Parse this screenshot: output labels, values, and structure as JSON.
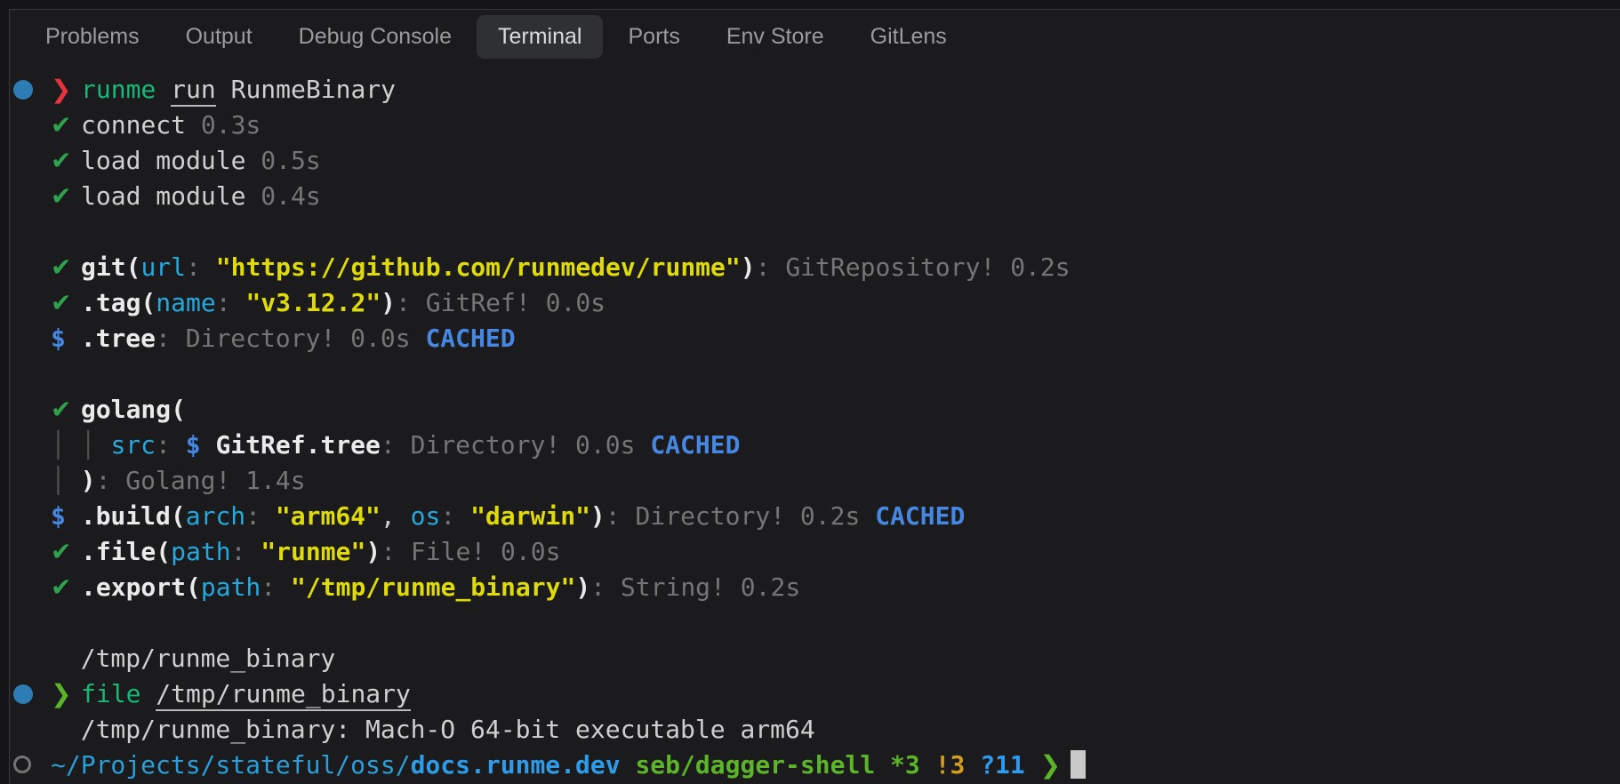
{
  "colors": {
    "panel_background": "#1b1b1d",
    "panel_border": "#3a3a3e",
    "tab_inactive_text": "#9b9b9b",
    "tab_active_background": "#2f3033",
    "tab_active_text": "#dadada",
    "terminal_foreground": "#cfcfcf",
    "result_gray": "#757575",
    "check_green": "#2fa24d",
    "command_emerald": "#17b877",
    "prompt_red": "#e6333d",
    "prompt_lime": "#5cb428",
    "param_cyan": "#25a8de",
    "string_yellow": "#dfdb0a",
    "cached_blue": "#4687e2",
    "untracked_blue": "#2d9cf0",
    "modified_orange": "#d29c20",
    "decoration_dot_blue": "#2d7cb5",
    "cursor": "#c9c9c9"
  },
  "tabs": {
    "items": [
      {
        "label": "Problems",
        "active": false
      },
      {
        "label": "Output",
        "active": false
      },
      {
        "label": "Debug Console",
        "active": false
      },
      {
        "label": "Terminal",
        "active": true
      },
      {
        "label": "Ports",
        "active": false
      },
      {
        "label": "Env Store",
        "active": false
      },
      {
        "label": "GitLens",
        "active": false
      }
    ]
  },
  "terminal": {
    "lines": [
      {
        "decoration": {
          "name": "command-decoration-dot",
          "type": "filled"
        },
        "segments": [
          {
            "text": "❯ ",
            "style": "red glyph"
          },
          {
            "text": "runme ",
            "style": "emerald"
          },
          {
            "text": "run",
            "style": "fg underline",
            "link": true
          },
          {
            "text": " RunmeBinary",
            "style": "fg"
          }
        ]
      },
      {
        "segments": [
          {
            "text": "✔ ",
            "style": "green glyph"
          },
          {
            "text": "connect ",
            "style": "fg"
          },
          {
            "text": "0.3s",
            "style": "gray"
          }
        ]
      },
      {
        "segments": [
          {
            "text": "✔ ",
            "style": "green glyph"
          },
          {
            "text": "load module ",
            "style": "fg"
          },
          {
            "text": "0.5s",
            "style": "gray"
          }
        ]
      },
      {
        "segments": [
          {
            "text": "✔ ",
            "style": "green glyph"
          },
          {
            "text": "load module ",
            "style": "fg"
          },
          {
            "text": "0.4s",
            "style": "gray"
          }
        ]
      },
      {
        "segments": []
      },
      {
        "segments": [
          {
            "text": "✔ ",
            "style": "green glyph"
          },
          {
            "text": "git(",
            "style": "boldfg"
          },
          {
            "text": "url",
            "style": "cyan"
          },
          {
            "text": ": ",
            "style": "gray"
          },
          {
            "text": "\"https://github.com/runmedev/runme\"",
            "style": "yellow",
            "link": true
          },
          {
            "text": ")",
            "style": "boldfg"
          },
          {
            "text": ": ",
            "style": "gray"
          },
          {
            "text": "GitRepository! 0.2s",
            "style": "gray"
          }
        ]
      },
      {
        "segments": [
          {
            "text": "✔ ",
            "style": "green glyph"
          },
          {
            "text": ".tag(",
            "style": "boldfg"
          },
          {
            "text": "name",
            "style": "cyan"
          },
          {
            "text": ": ",
            "style": "gray"
          },
          {
            "text": "\"v3.12.2\"",
            "style": "yellow"
          },
          {
            "text": ")",
            "style": "boldfg"
          },
          {
            "text": ": ",
            "style": "gray"
          },
          {
            "text": "GitRef! 0.0s",
            "style": "gray"
          }
        ]
      },
      {
        "segments": [
          {
            "text": "$ ",
            "style": "blue"
          },
          {
            "text": ".tree",
            "style": "boldfg"
          },
          {
            "text": ": ",
            "style": "gray"
          },
          {
            "text": "Directory! 0.0s ",
            "style": "gray"
          },
          {
            "text": "CACHED",
            "style": "blue"
          }
        ]
      },
      {
        "segments": []
      },
      {
        "segments": [
          {
            "text": "✔ ",
            "style": "green glyph"
          },
          {
            "text": "golang(",
            "style": "boldfg"
          }
        ]
      },
      {
        "segments": [
          {
            "text": "│ │ ",
            "style": "dim"
          },
          {
            "text": "src",
            "style": "cyan"
          },
          {
            "text": ": ",
            "style": "gray"
          },
          {
            "text": "$ ",
            "style": "blue"
          },
          {
            "text": "GitRef.tree",
            "style": "boldfg"
          },
          {
            "text": ": ",
            "style": "gray"
          },
          {
            "text": "Directory! 0.0s ",
            "style": "gray"
          },
          {
            "text": "CACHED",
            "style": "blue"
          }
        ]
      },
      {
        "segments": [
          {
            "text": "│ ",
            "style": "dim"
          },
          {
            "text": ")",
            "style": "boldfg"
          },
          {
            "text": ": ",
            "style": "gray"
          },
          {
            "text": "Golang! 1.4s",
            "style": "gray"
          }
        ]
      },
      {
        "segments": [
          {
            "text": "$ ",
            "style": "blue"
          },
          {
            "text": ".build(",
            "style": "boldfg"
          },
          {
            "text": "arch",
            "style": "cyan"
          },
          {
            "text": ": ",
            "style": "gray"
          },
          {
            "text": "\"arm64\"",
            "style": "yellow"
          },
          {
            "text": ", ",
            "style": "fg"
          },
          {
            "text": "os",
            "style": "cyan"
          },
          {
            "text": ": ",
            "style": "gray"
          },
          {
            "text": "\"darwin\"",
            "style": "yellow"
          },
          {
            "text": ")",
            "style": "boldfg"
          },
          {
            "text": ": ",
            "style": "gray"
          },
          {
            "text": "Directory! 0.2s ",
            "style": "gray"
          },
          {
            "text": "CACHED",
            "style": "blue"
          }
        ]
      },
      {
        "segments": [
          {
            "text": "✔ ",
            "style": "green glyph"
          },
          {
            "text": ".file(",
            "style": "boldfg"
          },
          {
            "text": "path",
            "style": "cyan"
          },
          {
            "text": ": ",
            "style": "gray"
          },
          {
            "text": "\"runme\"",
            "style": "yellow"
          },
          {
            "text": ")",
            "style": "boldfg"
          },
          {
            "text": ": ",
            "style": "gray"
          },
          {
            "text": "File! 0.0s",
            "style": "gray"
          }
        ]
      },
      {
        "segments": [
          {
            "text": "✔ ",
            "style": "green glyph"
          },
          {
            "text": ".export(",
            "style": "boldfg"
          },
          {
            "text": "path",
            "style": "cyan"
          },
          {
            "text": ": ",
            "style": "gray"
          },
          {
            "text": "\"/tmp/runme_binary\"",
            "style": "yellow"
          },
          {
            "text": ")",
            "style": "boldfg"
          },
          {
            "text": ": ",
            "style": "gray"
          },
          {
            "text": "String! 0.2s",
            "style": "gray"
          }
        ]
      },
      {
        "segments": []
      },
      {
        "segments": [
          {
            "text": "  /tmp/runme_binary",
            "style": "fg"
          }
        ]
      },
      {
        "decoration": {
          "name": "command-decoration-dot",
          "type": "filled"
        },
        "segments": [
          {
            "text": "❯ ",
            "style": "lime glyph"
          },
          {
            "text": "file ",
            "style": "emerald"
          },
          {
            "text": "/tmp/runme_binary",
            "style": "fg underline",
            "link": true
          }
        ]
      },
      {
        "segments": [
          {
            "text": "  /tmp/runme_binary: Mach-O 64-bit executable arm64",
            "style": "fg"
          }
        ]
      },
      {
        "decoration": {
          "name": "command-prompt-dot",
          "type": "hollow"
        },
        "segments": [
          {
            "text": "~/Projects/stateful/oss/",
            "style": "pathcyan"
          },
          {
            "text": "docs.runme.dev",
            "style": "linkblue",
            "link": true
          },
          {
            "text": " ",
            "style": "fg"
          },
          {
            "text": "seb/dagger-shell ",
            "style": "lime"
          },
          {
            "text": "*3 ",
            "style": "lime"
          },
          {
            "text": "!3 ",
            "style": "orange"
          },
          {
            "text": "?11 ",
            "style": "brightblue"
          },
          {
            "text": "❯ ",
            "style": "lime glyph"
          },
          {
            "text": "",
            "style": "cursor"
          }
        ]
      }
    ]
  }
}
